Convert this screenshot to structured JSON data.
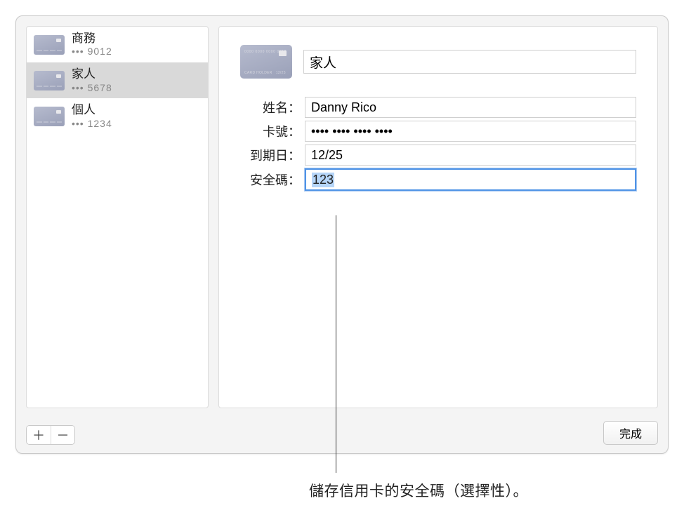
{
  "sidebar": {
    "cards": [
      {
        "name": "商務",
        "last": "••• 9012"
      },
      {
        "name": "家人",
        "last": "••• 5678"
      },
      {
        "name": "個人",
        "last": "••• 1234"
      }
    ]
  },
  "detail": {
    "title_value": "家人",
    "fields": {
      "name_label": "姓名：",
      "name_value": "Danny Rico",
      "number_label": "卡號：",
      "number_value": "•••• •••• •••• ••••",
      "expiry_label": "到期日：",
      "expiry_value": "12/25",
      "cvv_label": "安全碼：",
      "cvv_value": "123"
    }
  },
  "buttons": {
    "add": "＋",
    "remove": "－",
    "done": "完成"
  },
  "callout": "儲存信用卡的安全碼（選擇性）。"
}
